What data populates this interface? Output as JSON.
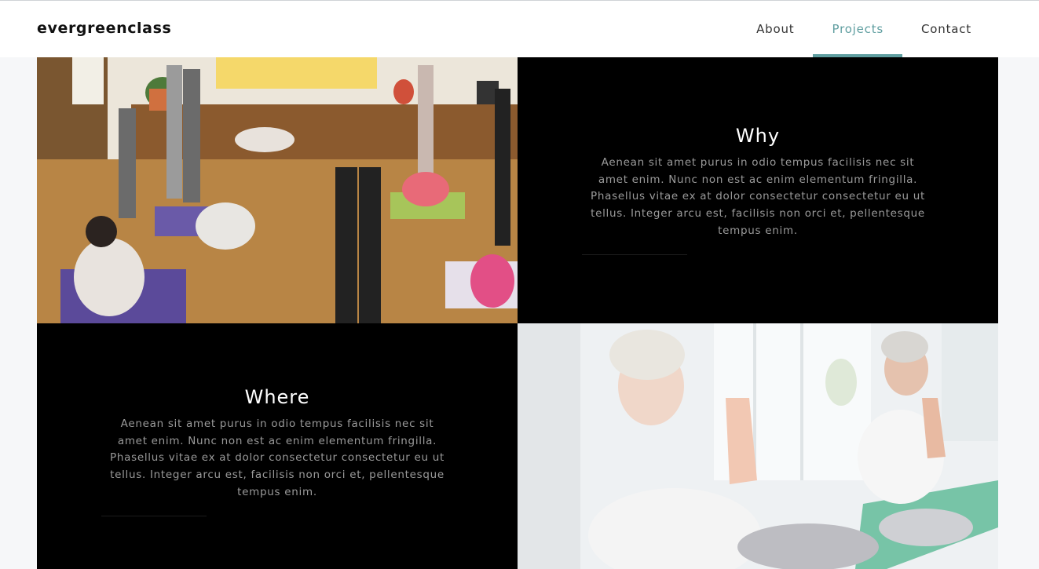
{
  "brand": "evergreenclass",
  "nav": {
    "items": [
      {
        "label": "About",
        "active": false
      },
      {
        "label": "Projects",
        "active": true
      },
      {
        "label": "Contact",
        "active": false
      }
    ]
  },
  "colors": {
    "accent": "#5f9ea0",
    "dark_tile": "#000000",
    "body_text": "#9a9a9a"
  },
  "sections": {
    "why": {
      "title": "Why",
      "text": "Aenean sit amet purus in odio tempus facilisis nec sit amet enim. Nunc non est ac enim elementum fringilla. Phasellus vitae ex at dolor consectetur consectetur eu ut tellus. Integer arcu est, facilisis non orci et, pellentesque tempus enim."
    },
    "where": {
      "title": "Where",
      "text": "Aenean sit amet purus in odio tempus facilisis nec sit amet enim. Nunc non est ac enim elementum fringilla. Phasellus vitae ex at dolor consectetur consectetur eu ut tellus. Integer arcu est, facilisis non orci et, pellentesque tempus enim."
    }
  },
  "images": {
    "class_photo": "yoga-class-photo",
    "meditation_photo": "senior-couple-meditation-photo"
  }
}
